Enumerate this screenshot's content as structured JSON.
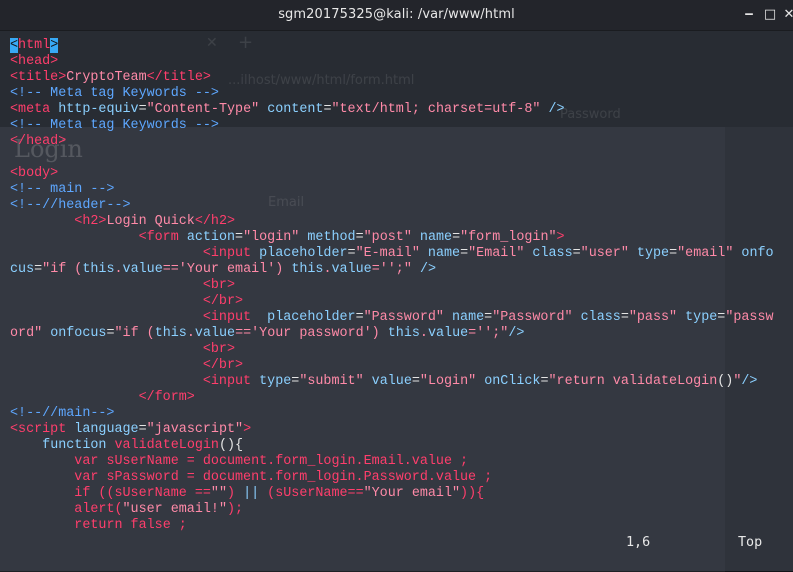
{
  "window": {
    "title": "sgm20175325@kali: /var/www/html",
    "minimize_glyph": "‒",
    "maximize_glyph": "□",
    "close_glyph": "✕"
  },
  "background_app": {
    "tab_close_glyph": "✕",
    "new_tab_glyph": "+",
    "url": "...ilhost/www/html/form.html",
    "heading": "Login",
    "field_text": "Email",
    "ghost_text": "Password"
  },
  "editor": {
    "lines": [
      "<html>",
      "<head>",
      "<title>CryptoTeam</title>",
      "<!-- Meta tag Keywords -->",
      "<meta http-equiv=\"Content-Type\" content=\"text/html; charset=utf-8\" />",
      "<!-- Meta tag Keywords -->",
      "</head>",
      "",
      "<body>",
      "<!-- main -->",
      "<!--//header-->",
      "        <h2>Login Quick</h2>",
      "                <form action=\"login\" method=\"post\" name=\"form_login\">",
      "                        <input placeholder=\"E-mail\" name=\"Email\" class=\"user\" type=\"email\" onfo",
      "cus=\"if (this.value=='Your email') this.value='';\" />",
      "                        <br>",
      "                        </br>",
      "                        <input  placeholder=\"Password\" name=\"Password\" class=\"pass\" type=\"passw",
      "ord\" onfocus=\"if (this.value=='Your password') this.value='';\"/>",
      "                        <br>",
      "                        </br>",
      "                        <input type=\"submit\" value=\"Login\" onClick=\"return validateLogin()\"/>",
      "                </form>",
      "<!--//main-->",
      "<script language=\"javascript\">",
      "    function validateLogin(){",
      "        var sUserName = document.form_login.Email.value ;",
      "        var sPassword = document.form_login.Password.value ;",
      "        if ((sUserName ==\"\") || (sUserName==\"Your email\")){",
      "        alert(\"user email!\");",
      "        return false ;"
    ],
    "cursor_position": "1,6",
    "scroll_indicator": "Top"
  },
  "colors": {
    "terminal_bg": "#2f333b",
    "titlebar_bg": "#23252b",
    "tag": "#ff3e6c",
    "attribute": "#8bd0ff",
    "string": "#ff8aa8",
    "comment": "#5ea7ff",
    "cursor": "#38a9f5"
  }
}
